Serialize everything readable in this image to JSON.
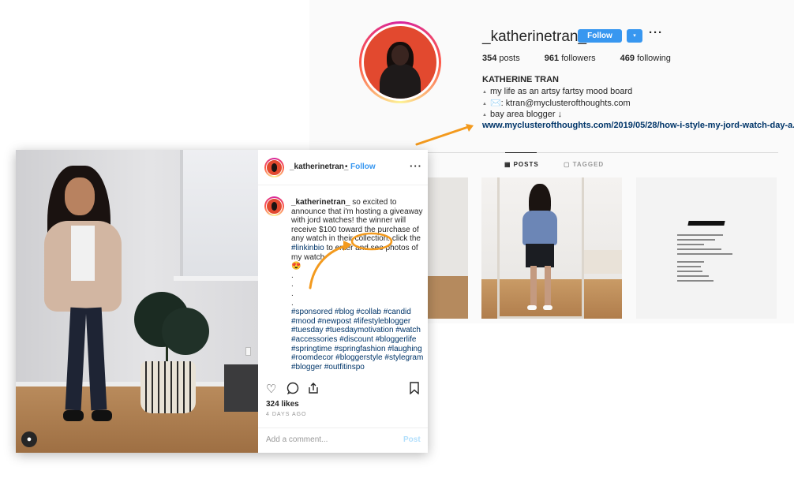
{
  "profile": {
    "username": "_katherinetran_",
    "follow_label": "Follow",
    "dropdown_glyph": "▾",
    "more_glyph": "···",
    "stats": {
      "posts_count": "354",
      "posts_label": "posts",
      "followers_count": "961",
      "followers_label": "followers",
      "following_count": "469",
      "following_label": "following"
    },
    "full_name": "KATHERINE TRAN",
    "bio": [
      "my life as an artsy fartsy mood board",
      "✉️: ktran@myclusterofthoughts.com",
      "bay area blogger ↓"
    ],
    "bio_bullet": "▲",
    "link": "www.myclusterofthoughts.com/2019/05/28/how-i-style-my-jord-watch-day-a...",
    "tabs": [
      {
        "icon": "▦",
        "label": "POSTS"
      },
      {
        "icon": "▢",
        "label": "TAGGED"
      }
    ],
    "poem_title": "the masterpiece",
    "poem_lines": [
      "handed my heart to you on a silver platter",
      "for you to shatter it repeatedly",
      "like it didn't matter",
      "i was the first to pick up the pieces",
      "for you to create another one of your masterpieces",
      "my broken heart",
      "your piece of art",
      "lying on the floor",
      "then back to your hands",
      "for you to break once more"
    ]
  },
  "post": {
    "username": "_katherinetran_",
    "dot": "•",
    "follow_label": "Follow",
    "more_glyph": "···",
    "caption_lines": [
      "so excited to announce that i'm hosting a giveaway with jord watches! the winner will receive $100 toward the purchase of any watch in their collection. click the",
      "#linkinbio",
      "to enter and see photos of my watch",
      "😍"
    ],
    "dots": [
      ".",
      ".",
      ".",
      "."
    ],
    "hashtags": "#sponsored #blog #collab #candid #mood #newpost #lifestyleblogger #tuesday #tuesdaymotivation #watch #accessories #discount #bloggerlife #springtime #springfashion #laughing #roomdecor #bloggerstyle #stylegram #blogger #outfitinspo",
    "icons": {
      "like": "heart-icon",
      "comment": "comment-icon",
      "share": "share-icon",
      "save": "bookmark-icon",
      "tag": "person-tag-icon"
    },
    "likes": "324 likes",
    "time": "4 DAYS AGO",
    "comment_placeholder": "Add a comment...",
    "post_label": "Post"
  },
  "colors": {
    "accent_blue": "#3897f0",
    "link_blue": "#003569",
    "annotation_orange": "#f39a1e"
  }
}
